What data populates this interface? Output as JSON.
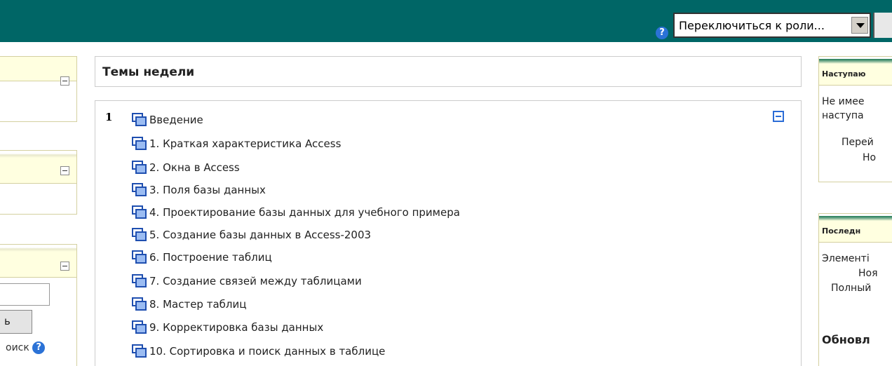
{
  "header": {
    "role_select": {
      "value": "Переключиться к роли..."
    }
  },
  "left": {
    "search_button_label": "ь",
    "advanced_search_label": "оиск"
  },
  "main": {
    "title": "Темы недели",
    "section_number": "1",
    "topics": [
      "Введение",
      "1. Краткая характеристика Access",
      "2. Окна в Access",
      "3. Поля базы данных",
      "4. Проектирование базы данных для учебного примера",
      "5. Создание базы данных в Access-2003",
      "6. Построение таблиц",
      "7. Создание связей между таблицами",
      "8. Мастер таблиц",
      "9. Корректировка базы данных",
      "10. Сортировка и поиск данных в таблице"
    ]
  },
  "right": {
    "upcoming": {
      "title": "Наступаю",
      "line1": "Не имее",
      "line2": "наступа",
      "line3": "Перей",
      "line4": "Но"
    },
    "recent": {
      "title": "Последн",
      "line1": "Элементі",
      "line2": "Ноя",
      "line3": "Полный",
      "updated": "Обновл"
    }
  },
  "icons": {
    "help": "help-icon",
    "collapse": "collapse-icon",
    "topic": "resource-icon"
  },
  "colors": {
    "topbar": "#006666",
    "accent": "#2b6cd6",
    "block_header": "#ffffe0"
  }
}
